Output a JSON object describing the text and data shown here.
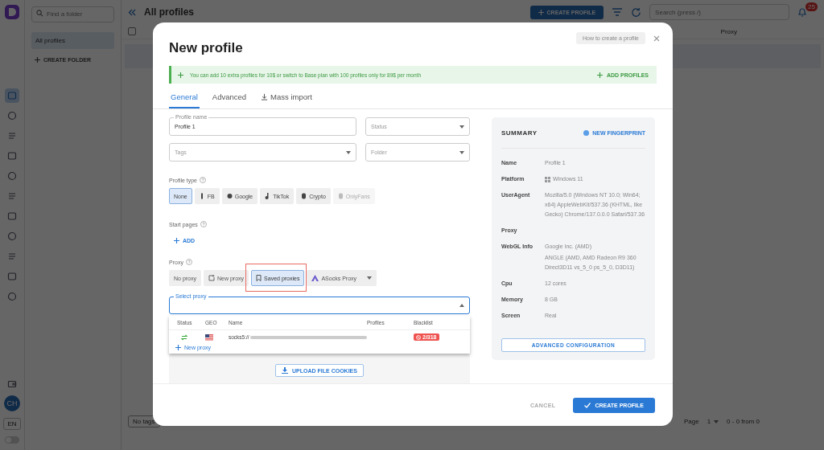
{
  "app": {
    "folder_search": {
      "placeholder": "Find a folder"
    },
    "folders": [
      {
        "label": "All profiles",
        "selected": true
      }
    ],
    "create_folder": "CREATE FOLDER",
    "rail": [
      {
        "selected": true
      },
      {
        "selected": false
      },
      {
        "selected": false
      },
      {
        "selected": false
      },
      {
        "selected": false
      },
      {
        "selected": false
      },
      {
        "selected": false
      },
      {
        "selected": false
      },
      {
        "selected": false
      },
      {
        "selected": false
      },
      {
        "selected": false
      }
    ],
    "title": "All profiles",
    "create_button": "CREATE PROFILE",
    "search": {
      "placeholder": "Search (press /)"
    },
    "notifications": "25",
    "select_all": {
      "checked": false
    },
    "theme_toggle": {
      "on": false
    },
    "columns": [
      "Proxy"
    ],
    "tag_filter": "No tags",
    "pagination": {
      "label": "Page",
      "page": "1",
      "range": "0 - 0 from 0"
    },
    "avatar": "CH",
    "language": "EN"
  },
  "dialog": {
    "title": "New profile",
    "help_button": "How to create a profile",
    "banner": {
      "text": "You can add 10 extra profiles for 10$ or switch to Base plan with 100 profiles only for 89$ per month",
      "action": "ADD PROFILES"
    },
    "tabs": [
      {
        "label": "General",
        "selected": true
      },
      {
        "label": "Advanced",
        "selected": false
      },
      {
        "label": "Mass import",
        "selected": false
      }
    ],
    "fields": [
      {
        "label": "Profile name",
        "value": "Profile 1",
        "kind": "text"
      },
      {
        "placeholder": "Status",
        "kind": "select"
      },
      {
        "placeholder": "Tags",
        "kind": "select"
      },
      {
        "placeholder": "Folder",
        "kind": "select"
      }
    ],
    "profile_type": {
      "label": "Profile type",
      "options": [
        {
          "label": "None",
          "selected": true,
          "disabled": false
        },
        {
          "label": "FB",
          "selected": false,
          "disabled": false
        },
        {
          "label": "Google",
          "selected": false,
          "disabled": false
        },
        {
          "label": "TikTok",
          "selected": false,
          "disabled": false
        },
        {
          "label": "Crypto",
          "selected": false,
          "disabled": false
        },
        {
          "label": "OnlyFans",
          "selected": false,
          "disabled": true
        }
      ]
    },
    "start_pages": {
      "label": "Start pages",
      "add": "ADD"
    },
    "proxy": {
      "label": "Proxy",
      "options": [
        {
          "label": "No proxy",
          "selected": false,
          "highlighted": false
        },
        {
          "label": "New proxy",
          "selected": false,
          "highlighted": false
        },
        {
          "label": "Saved proxies",
          "selected": true,
          "highlighted": true
        },
        {
          "label": "ASocks Proxy",
          "selected": false,
          "highlighted": false
        }
      ],
      "select": {
        "label": "Select proxy",
        "expanded": true
      },
      "menu": {
        "columns": [
          "Status",
          "GEO",
          "Name",
          "Profiles",
          "Blacklist"
        ],
        "rows": [
          {
            "name": "socks5://",
            "blacklist": "2/318"
          }
        ],
        "new": "New proxy"
      }
    },
    "upload": "UPLOAD FILE COOKIES",
    "summary": {
      "title": "SUMMARY",
      "action": "NEW FINGERPRINT",
      "rows": [
        {
          "label": "Name",
          "value": "Profile 1",
          "kind": "text"
        },
        {
          "label": "Platform",
          "value": "Windows 11",
          "kind": "os"
        },
        {
          "label": "UserAgent",
          "value": "Mozilla/5.0 (Windows NT 10.0; Win64; x64) AppleWebKit/537.36 (KHTML, like Gecko) Chrome/137.0.0.0 Safari/537.36",
          "kind": "text"
        },
        {
          "label": "Proxy",
          "kind": "empty"
        },
        {
          "label": "WebGL Info",
          "value": "Google Inc. (AMD)",
          "detail": "ANGLE (AMD, AMD Radeon R9 360 Direct3D11 vs_5_0 ps_5_0, D3D11)",
          "kind": "text"
        },
        {
          "label": "Cpu",
          "value": "12 cores",
          "kind": "text"
        },
        {
          "label": "Memory",
          "value": "8 GB",
          "kind": "text"
        },
        {
          "label": "Screen",
          "value": "Real",
          "kind": "text"
        }
      ],
      "advanced": "ADVANCED CONFIGURATION"
    },
    "cancel": "CANCEL",
    "submit": "CREATE PROFILE"
  }
}
